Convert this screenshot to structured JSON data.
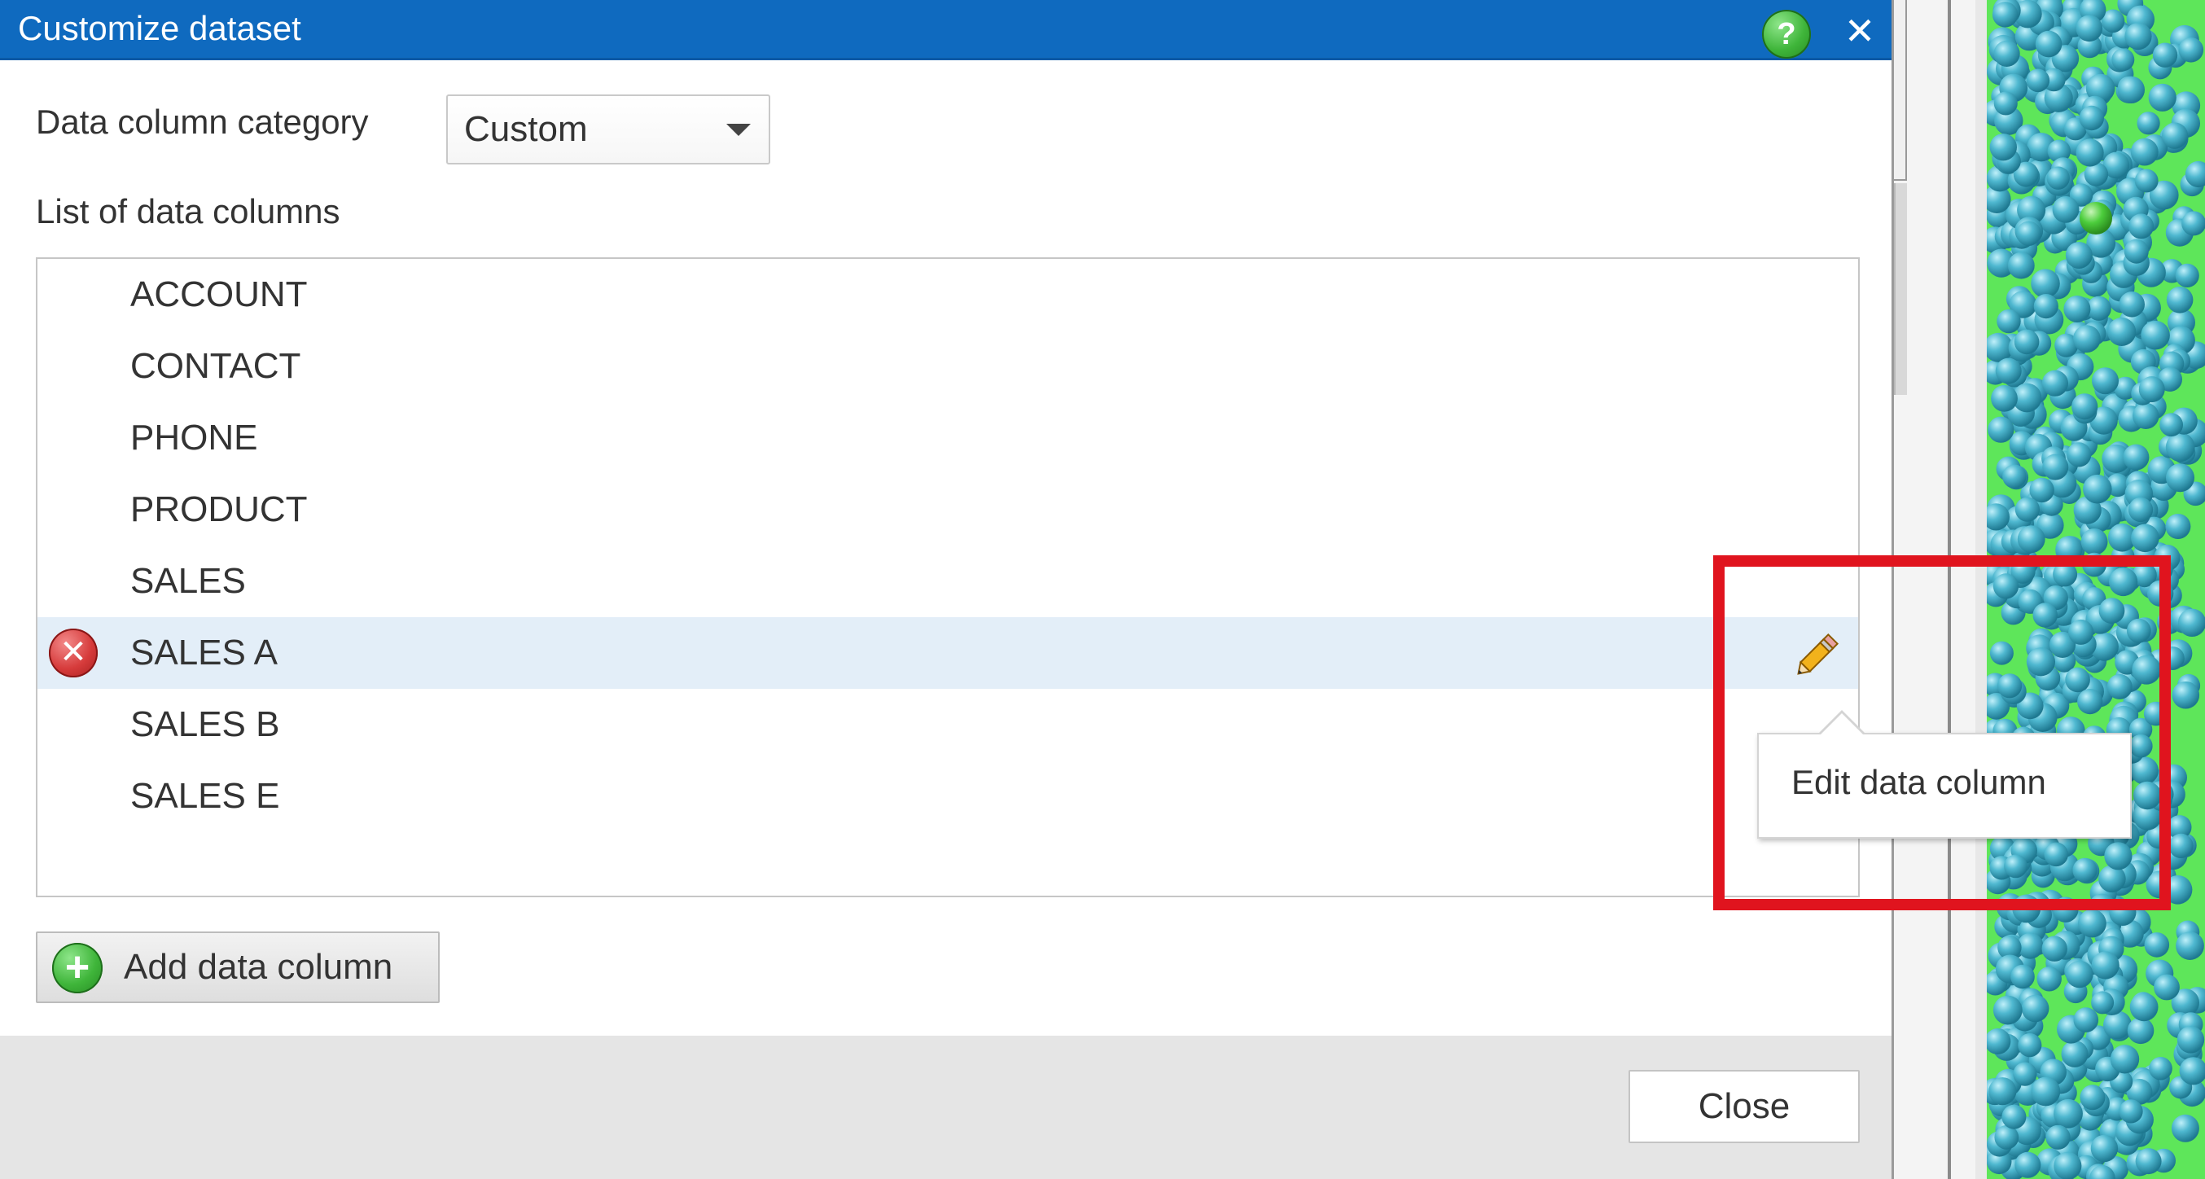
{
  "dialog": {
    "title": "Customize dataset",
    "help_icon_glyph": "?",
    "close_icon_glyph": "✕",
    "title_bar_color": "#0f6abf"
  },
  "category": {
    "label": "Data column category",
    "selected_value": "Custom"
  },
  "list": {
    "label": "List of data columns",
    "items": [
      {
        "label": "ACCOUNT"
      },
      {
        "label": "CONTACT"
      },
      {
        "label": "PHONE"
      },
      {
        "label": "PRODUCT"
      },
      {
        "label": "SALES"
      },
      {
        "label": "SALES A",
        "selected": true
      },
      {
        "label": "SALES B"
      },
      {
        "label": "SALES E"
      }
    ],
    "selected_row_color": "#e3eef8"
  },
  "row_actions": {
    "delete_icon": "delete-icon",
    "delete_glyph": "✕",
    "edit_icon": "pencil-icon"
  },
  "tooltip": {
    "text": "Edit data column"
  },
  "highlight": {
    "color": "#e0141e"
  },
  "add_button": {
    "label": "Add data column",
    "icon_glyph": "+"
  },
  "footer": {
    "close_label": "Close"
  }
}
